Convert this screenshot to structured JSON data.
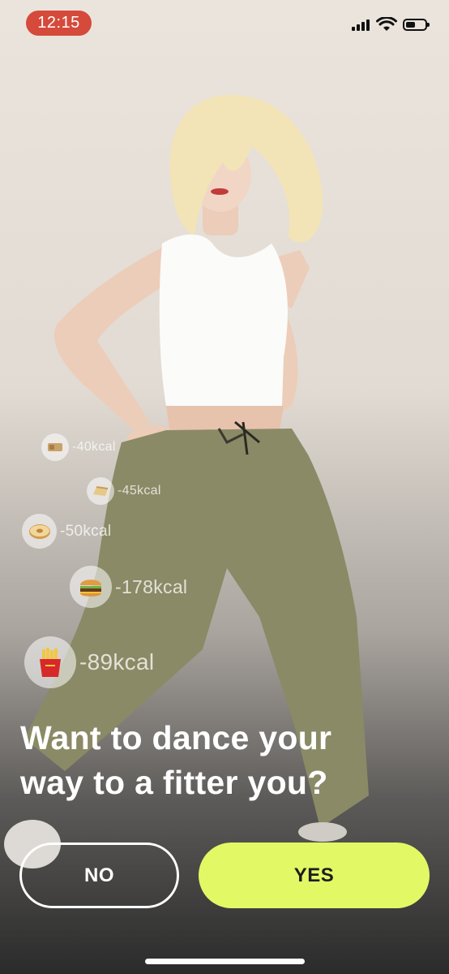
{
  "status_bar": {
    "time": "12:15",
    "battery_level": 0.5
  },
  "kcal_items": [
    {
      "icon": "cookie-icon",
      "label": "-40kcal"
    },
    {
      "icon": "bread-icon",
      "label": "-45kcal"
    },
    {
      "icon": "donut-icon",
      "label": "-50kcal"
    },
    {
      "icon": "burger-icon",
      "label": "-178kcal"
    },
    {
      "icon": "fries-icon",
      "label": "-89kcal"
    }
  ],
  "headline": {
    "line1": "Want to dance your",
    "line2": "way to a fitter you?"
  },
  "buttons": {
    "no": "NO",
    "yes": "YES"
  },
  "colors": {
    "yes_button": "#e3f865",
    "time_pill": "#d54a3a",
    "pants": "#8a8a66"
  }
}
